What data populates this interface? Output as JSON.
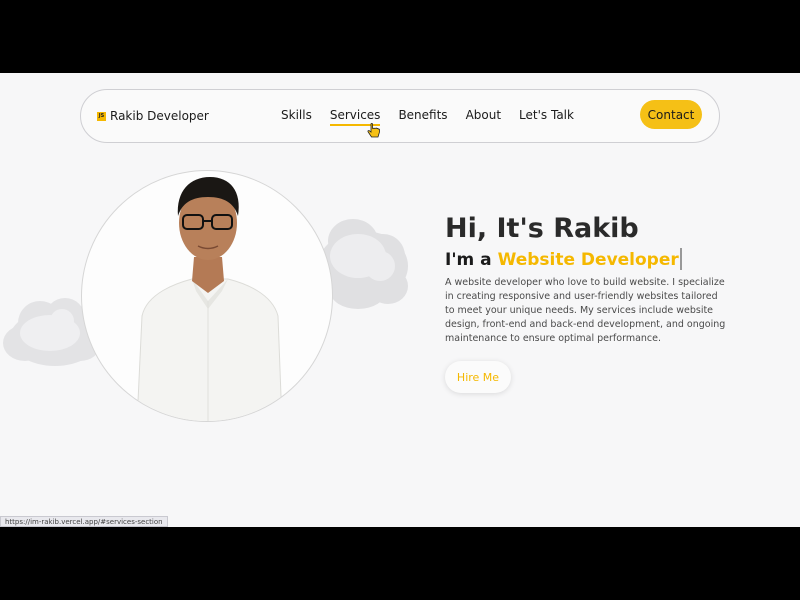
{
  "brand": {
    "logo_text": "JS",
    "name": "Rakib Developer"
  },
  "nav": {
    "links": [
      {
        "label": "Skills"
      },
      {
        "label": "Services",
        "active": true
      },
      {
        "label": "Benefits"
      },
      {
        "label": "About"
      },
      {
        "label": "Let's Talk"
      }
    ],
    "contact_label": "Contact"
  },
  "hero": {
    "title": "Hi, It's Rakib",
    "subtitle_prefix": "I'm a ",
    "subtitle_highlight": "Website Developer",
    "description": "A website developer who love to build website. I specialize in creating responsive and user-friendly websites tailored to meet your unique needs. My services include website design, front-end and back-end development, and ongoing maintenance to ensure optimal performance.",
    "hire_label": "Hire Me"
  },
  "status_bar": {
    "url": "https://im-rakib.vercel.app/#services-section"
  },
  "colors": {
    "accent": "#f5c016",
    "text": "#1b1b1b",
    "background": "#f7f7f8"
  },
  "icons": [
    "hand-pointer-icon",
    "cloud-icon",
    "profile-photo"
  ]
}
